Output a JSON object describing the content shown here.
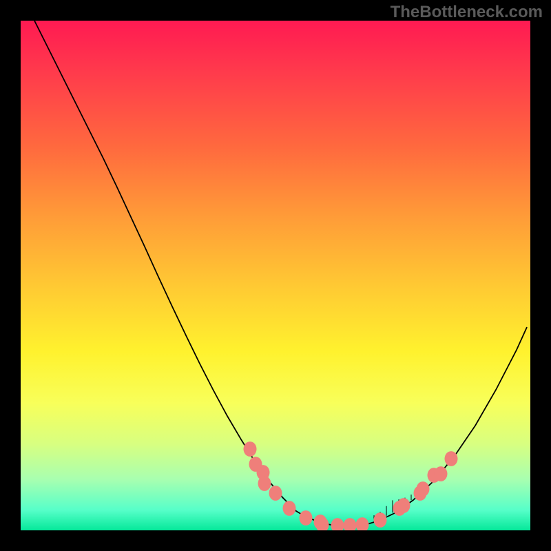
{
  "watermark": "TheBottleneck.com",
  "chart_data": {
    "type": "line",
    "title": "",
    "xlabel": "",
    "ylabel": "",
    "xlim": [
      0,
      740
    ],
    "ylim": [
      0,
      740
    ],
    "series": [
      {
        "name": "bottleneck-curve",
        "stroke": "#000000",
        "stroke_width": 1.8,
        "x": [
          20,
          40,
          60,
          80,
          100,
          120,
          140,
          160,
          180,
          200,
          220,
          240,
          260,
          280,
          300,
          320,
          340,
          360,
          380,
          400,
          410,
          430,
          450,
          470,
          485,
          500,
          520,
          545,
          570,
          600,
          630,
          660,
          690,
          720,
          735
        ],
        "y": [
          740,
          700,
          660,
          620,
          580,
          540,
          498,
          455,
          412,
          368,
          325,
          283,
          242,
          203,
          166,
          132,
          100,
          72,
          48,
          28,
          22,
          13,
          8,
          7,
          7,
          8,
          14,
          26,
          44,
          72,
          108,
          152,
          204,
          262,
          295
        ]
      }
    ],
    "markers": [
      {
        "name": "salmon-dots",
        "fill": "#ef7f7a",
        "radius": 9.5,
        "points": [
          {
            "x": 333,
            "y": 118
          },
          {
            "x": 341,
            "y": 96
          },
          {
            "x": 352,
            "y": 84
          },
          {
            "x": 354,
            "y": 68
          },
          {
            "x": 370,
            "y": 54
          },
          {
            "x": 390,
            "y": 32
          },
          {
            "x": 414,
            "y": 18
          },
          {
            "x": 435,
            "y": 12
          },
          {
            "x": 438,
            "y": 8
          },
          {
            "x": 460,
            "y": 7
          },
          {
            "x": 478,
            "y": 7
          },
          {
            "x": 496,
            "y": 8
          },
          {
            "x": 522,
            "y": 15
          },
          {
            "x": 550,
            "y": 32
          },
          {
            "x": 556,
            "y": 36
          },
          {
            "x": 580,
            "y": 54
          },
          {
            "x": 584,
            "y": 60
          },
          {
            "x": 600,
            "y": 80
          },
          {
            "x": 610,
            "y": 82
          },
          {
            "x": 625,
            "y": 104
          }
        ]
      }
    ],
    "ticks": [
      {
        "x": 513,
        "h": 8
      },
      {
        "x": 522,
        "h": 10
      },
      {
        "x": 531,
        "h": 14
      },
      {
        "x": 540,
        "h": 18
      },
      {
        "x": 549,
        "h": 14
      },
      {
        "x": 558,
        "h": 10
      },
      {
        "x": 567,
        "h": 8
      }
    ]
  }
}
